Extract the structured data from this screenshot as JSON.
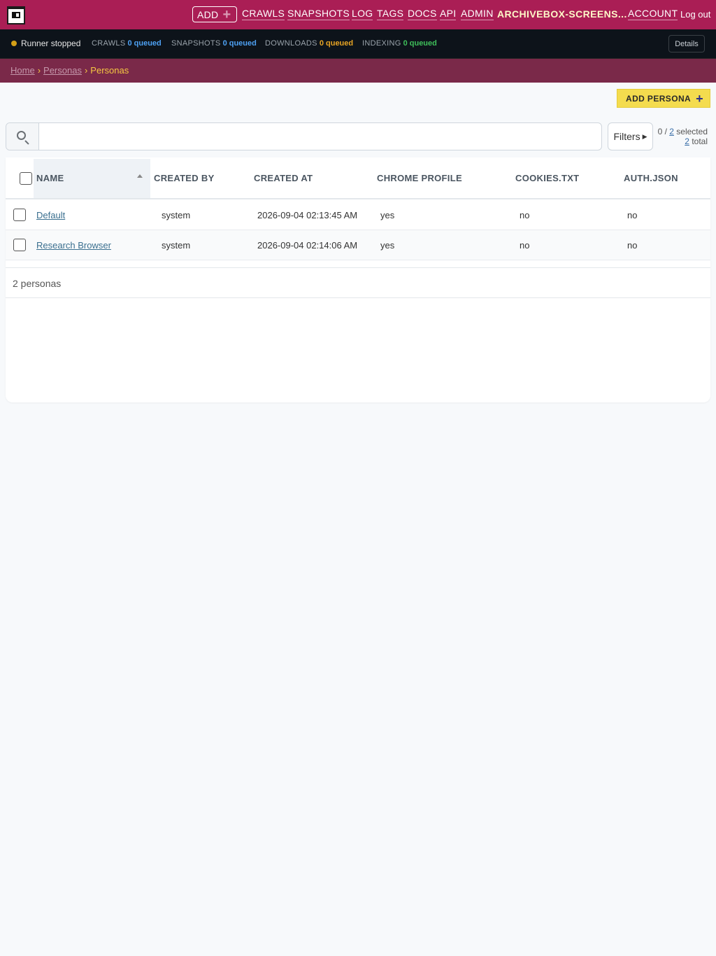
{
  "nav": {
    "add_label": "ADD",
    "links": [
      "CRAWLS",
      "SNAPSHOTS",
      "LOG",
      "TAGS",
      "DOCS",
      "API",
      "ADMIN"
    ],
    "brand": "ARCHIVEBOX-SCREENS...",
    "account": "ACCOUNT",
    "logout": "Log out"
  },
  "status": {
    "runner": "Runner stopped",
    "crawls_label": "CRAWLS",
    "crawls_value": "0 queued",
    "snapshots_label": "SNAPSHOTS",
    "snapshots_value": "0 queued",
    "downloads_label": "DOWNLOADS",
    "downloads_value": "0 queued",
    "indexing_label": "INDEXING",
    "indexing_value": "0 queued",
    "details": "Details",
    "colors": {
      "crawls": "#4ea1f3",
      "snapshots": "#4ea1f3",
      "downloads": "#e7a424",
      "indexing": "#3fbf5a",
      "runner_dot": "#d4a017"
    }
  },
  "breadcrumb": {
    "home": "Home",
    "section": "Personas",
    "current": "Personas"
  },
  "toolbar": {
    "add_persona": "ADD PERSONA",
    "search_placeholder": "",
    "filters": "Filters",
    "selected_count": "0",
    "selected_total": "2",
    "selected_suffix": "selected",
    "total_count": "2",
    "total_suffix": "total"
  },
  "table": {
    "columns": [
      "NAME",
      "CREATED BY",
      "CREATED AT",
      "CHROME PROFILE",
      "COOKIES.TXT",
      "AUTH.JSON"
    ],
    "rows": [
      {
        "name": "Default",
        "created_by": "system",
        "created_at": "2026-09-04 02:13:45 AM",
        "chrome_profile": "yes",
        "cookies": "no",
        "auth": "no"
      },
      {
        "name": "Research Browser",
        "created_by": "system",
        "created_at": "2026-09-04 02:14:06 AM",
        "chrome_profile": "yes",
        "cookies": "no",
        "auth": "no"
      }
    ],
    "footer": "2 personas"
  }
}
